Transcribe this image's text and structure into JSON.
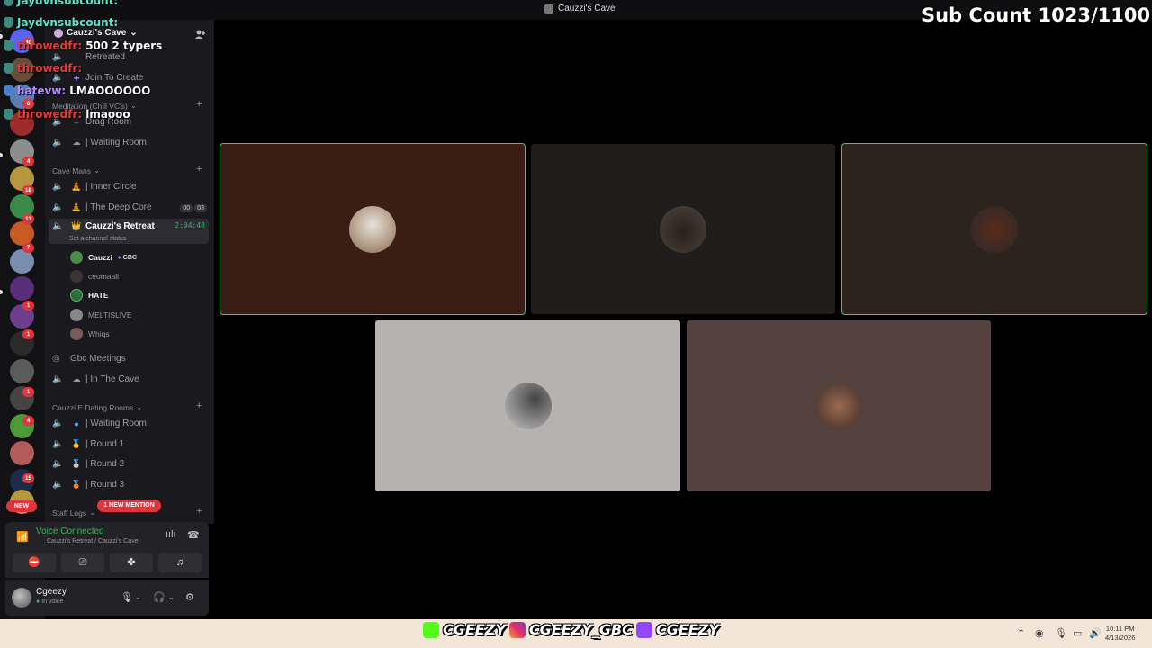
{
  "window": {
    "title": "Cauzzi's Cave"
  },
  "overlay": {
    "sub_count": "Sub Count 1023/1100",
    "chat": [
      {
        "name": "Jaydvnsubcount:",
        "message": "",
        "color": "teal"
      },
      {
        "name": "Jaydvnsubcount:",
        "message": "",
        "color": "teal"
      },
      {
        "name": "throwedfr:",
        "message": "500 2 typers",
        "color": "red"
      },
      {
        "name": "throwedfr:",
        "message": "",
        "color": "red"
      },
      {
        "name": "hatevw:",
        "message": "LMAOOOOOO",
        "color": "purple"
      },
      {
        "name": "throwedfr:",
        "message": "lmaooo",
        "color": "red"
      }
    ],
    "socials": [
      "CGEEZY",
      "CGEEZY_GBC",
      "CGEEZY"
    ]
  },
  "server_rail": {
    "badges": [
      "40",
      "6",
      "4",
      "18",
      "11",
      "7",
      "1",
      "1",
      "1",
      "4",
      "15"
    ],
    "new_label": "NEW"
  },
  "sidebar": {
    "server_name": "Cauzzi's Cave",
    "channels_top": [
      {
        "name": "Retreated",
        "emoji": ""
      },
      {
        "name": "Join To Create",
        "emoji": "+"
      }
    ],
    "category_meditation": "Meditation (Chill VC's)",
    "channels_meditation": [
      {
        "name": "Drag Room",
        "emoji": ""
      },
      {
        "name": "| Waiting Room",
        "emoji": ""
      }
    ],
    "category_cave": "Cave Mans",
    "channels_cave": [
      {
        "name": "| Inner Circle",
        "emoji": ""
      },
      {
        "name": "| The Deep Core",
        "emoji": "",
        "badge1": "00",
        "badge2": "03"
      }
    ],
    "active_channel": {
      "name": "Cauzzi's Retreat",
      "time": "2:04:48",
      "status": "Set a channel status"
    },
    "voice_users": [
      {
        "name": "Cauzzi",
        "tag": "GBC",
        "color": "#eee"
      },
      {
        "name": "ceomaali",
        "tag": "",
        "color": "#999"
      },
      {
        "name": "HATE",
        "tag": "",
        "color": "#eee"
      },
      {
        "name": "MELTISLIVE",
        "tag": "",
        "color": "#999"
      },
      {
        "name": "Whiqs",
        "tag": "",
        "color": "#999"
      }
    ],
    "channels_after": [
      {
        "name": "Gbc Meetings"
      },
      {
        "name": "| In The Cave"
      }
    ],
    "category_dating": "Cauzzi E Dating Rooms",
    "channels_dating": [
      {
        "name": "| Waiting Room"
      },
      {
        "name": "| Round 1"
      },
      {
        "name": "| Round 2"
      },
      {
        "name": "| Round 3"
      }
    ],
    "category_staff": "Staff Logs",
    "mention": "1 NEW MENTION"
  },
  "voice_panel": {
    "status": "Voice Connected",
    "location": "Cauzzi's Retreat / Cauzzi's Cave"
  },
  "user_panel": {
    "name": "Cgeezy",
    "status": "In voice"
  },
  "taskbar": {
    "time": "10:11 PM",
    "date": "4/13/2026"
  },
  "colors": {
    "speaking": "#4fbf6b",
    "voice_connected": "#3bb35e",
    "mention": "#e0353d"
  }
}
